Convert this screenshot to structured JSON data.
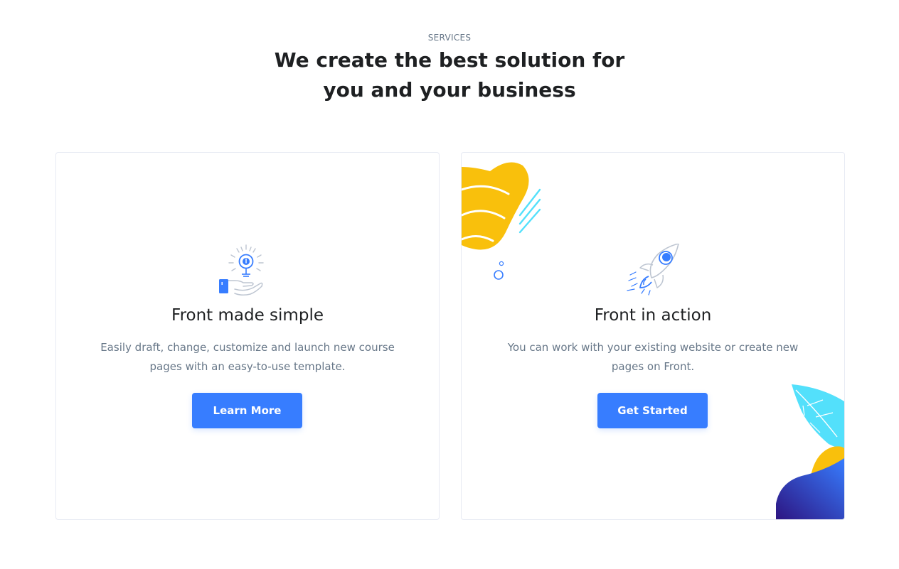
{
  "header": {
    "eyebrow": "SERVICES",
    "title_line1": "We create the best solution for",
    "title_line2": "you and your business"
  },
  "cards": [
    {
      "icon": "lightbulb-hand-icon",
      "title": "Front made simple",
      "text": "Easily draft, change, customize and launch new course pages with an easy-to-use template.",
      "button": "Learn More"
    },
    {
      "icon": "rocket-icon",
      "title": "Front in action",
      "text": "You can work with your existing website or create new pages on Front.",
      "button": "Get Started"
    }
  ],
  "colors": {
    "primary": "#377dff",
    "heading": "#1e2022",
    "body_text": "#677788",
    "accent_yellow": "#f9c00c",
    "accent_cyan": "#53e0fb",
    "accent_indigo": "#2d1582"
  }
}
